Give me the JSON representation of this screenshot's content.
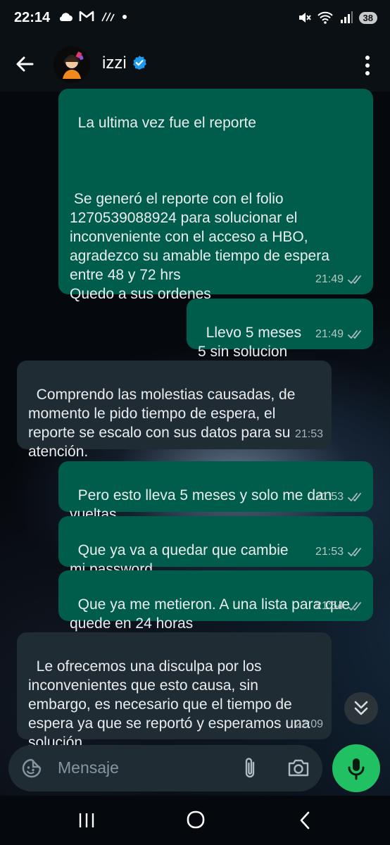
{
  "status_bar": {
    "time": "22:14",
    "battery": "38",
    "icons": [
      "cloud-icon",
      "gmail-icon",
      "teams-icon",
      "dot-icon",
      "mute-icon",
      "wifi-icon",
      "signal-icon"
    ]
  },
  "header": {
    "contact_name": "izzi",
    "verified": true
  },
  "messages": [
    {
      "type": "outgoing",
      "text": "La ultima vez fue el reporte\n\n\n\n Se generó el reporte con el folio 1270539088924 para solucionar el inconveniente con el acceso a HBO, agradezco su amable tiempo de espera entre 48 y 72 hrs\nQuedo a sus ordenes",
      "time": "21:49",
      "status": "read"
    },
    {
      "type": "outgoing",
      "text": "Llevo 5 meses\n5 sin solucion",
      "time": "21:49",
      "status": "read"
    },
    {
      "type": "incoming",
      "text": "Comprendo las molestias causadas, de momento le pido tiempo de espera, el reporte se escalo con sus datos para su atención.",
      "time": "21:53"
    },
    {
      "type": "outgoing",
      "text": "Pero esto lleva 5 meses y solo me dan vueltas",
      "time": "21:53",
      "status": "read"
    },
    {
      "type": "outgoing",
      "text": "Que ya va a quedar que cambie mi password",
      "time": "21:53",
      "status": "read"
    },
    {
      "type": "outgoing",
      "text": "Que ya me metieron. A una lista para que quede en 24 horas",
      "time": "21:54",
      "status": "read"
    },
    {
      "type": "incoming",
      "text": "Le ofrecemos una disculpa por los inconvenientes que esto causa, sin embargo, es necesario que el tiempo de espera ya que se reportó y esperamos una solución.",
      "time": "22:09"
    }
  ],
  "input": {
    "placeholder": "Mensaje"
  },
  "colors": {
    "outgoing_bubble": "#005c4b",
    "incoming_bubble": "#202c33",
    "mic_button": "#21c063",
    "verified_badge": "#1d9bf0",
    "read_ticks": "#aebcc1"
  }
}
